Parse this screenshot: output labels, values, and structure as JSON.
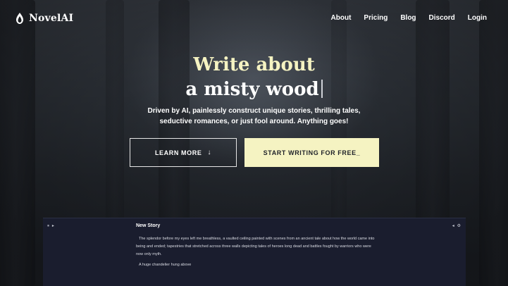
{
  "header": {
    "logo_text": "NovelAI",
    "logo_icon": "quill-flame-icon",
    "nav": [
      "About",
      "Pricing",
      "Blog",
      "Discord",
      "Login"
    ]
  },
  "hero": {
    "title_line1": "Write about",
    "title_line2": "a misty wood",
    "subtitle_line1": "Driven by AI, painlessly construct unique stories, thrilling tales,",
    "subtitle_line2": "seductive romances, or just fool around. Anything goes!",
    "learn_more_label": "LEARN MORE",
    "learn_more_icon": "arrow-down-icon",
    "start_label": "START WRITING FOR FREE_"
  },
  "editor": {
    "title": "New Story",
    "left_controls": "⏸ ▸",
    "right_controls": "◂ ⚙",
    "paragraph1": "The splendor before my eyes left me breathless, a vaulted ceiling painted with scenes from an ancient tale about how the world came into being and ended; tapestries that stretched across three walls depicting tales of heroes long dead and battles fought by warriors who were now only myth.",
    "paragraph2": "A huge chandelier hung above"
  },
  "colors": {
    "accent": "#f5f3c2",
    "background": "#1f2229",
    "editor_bg": "#1a1d2e"
  }
}
